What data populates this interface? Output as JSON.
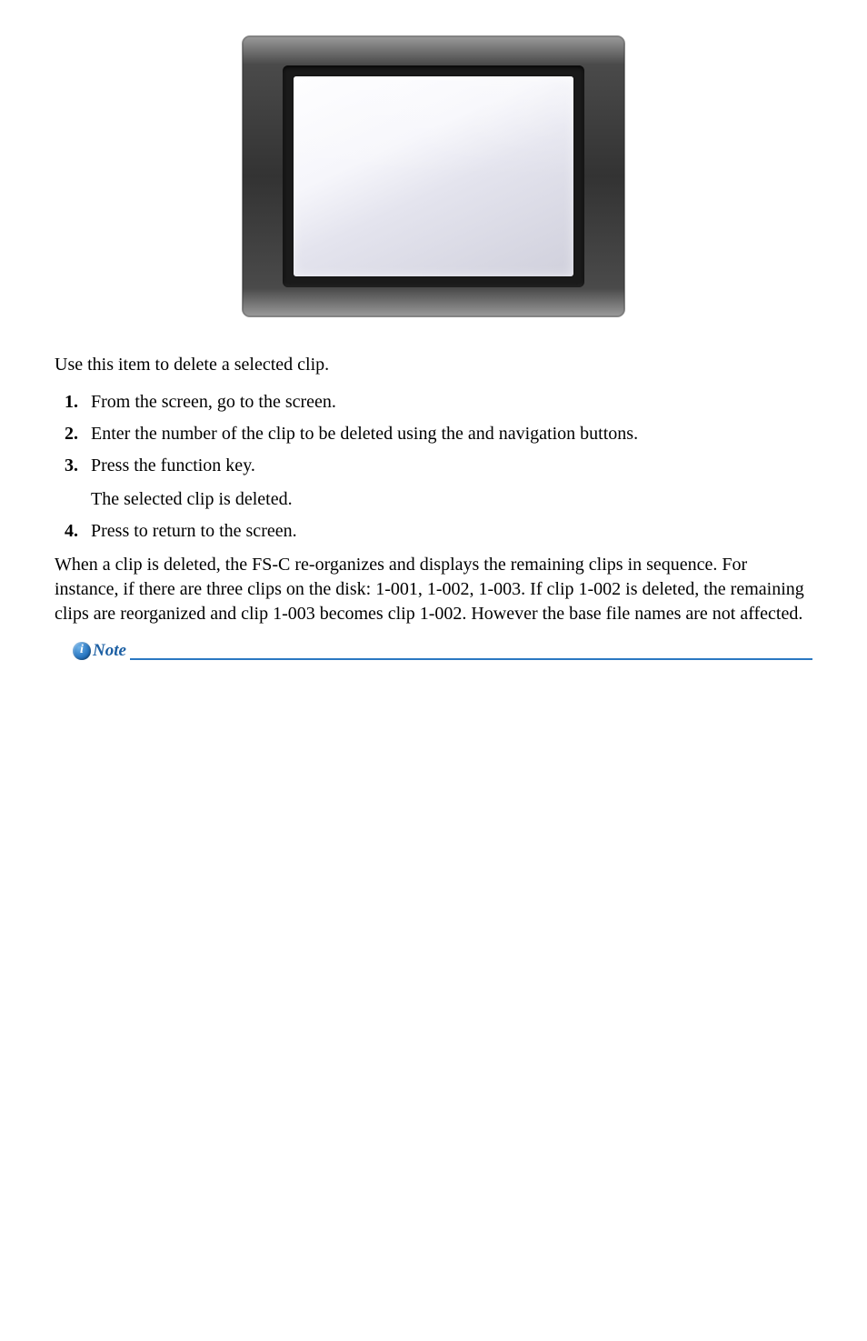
{
  "intro": "Use this item to delete a selected clip.",
  "steps": [
    "From the            screen, go to the                         screen.",
    "Enter the number of the clip to be deleted using the        and     navigation buttons.",
    "Press the         function key."
  ],
  "after_press": "The selected clip is deleted.",
  "step4": "Press             to return to the                screen.",
  "closing": "When a clip is deleted, the FS-C re-organizes and displays the remaining clips in sequence. For instance, if there are three clips on the disk: 1-001, 1-002, 1-003. If clip 1-002 is deleted, the remaining clips are reorganized and clip 1-003 becomes clip 1-002. However the base file names are not affected.",
  "note_label": "Note"
}
